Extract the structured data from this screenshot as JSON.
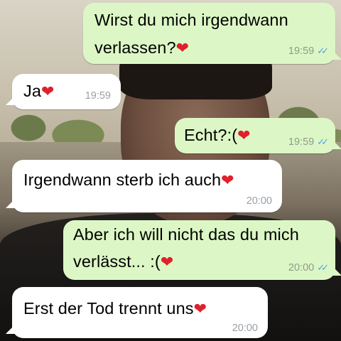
{
  "chat": {
    "messages": [
      {
        "line1": "Wirst du mich irgendwann",
        "line2": "verlassen?",
        "heart": "❤",
        "time": "19:59",
        "ticks": "✓✓"
      },
      {
        "line1": "Ja",
        "heart": "❤",
        "time": "19:59"
      },
      {
        "line1": "Echt?:(",
        "heart": "❤",
        "time": "19:59",
        "ticks": "✓✓"
      },
      {
        "line1": "Irgendwann sterb ich auch",
        "heart": "❤",
        "time": "20:00"
      },
      {
        "line1": "Aber ich will nicht das du mich",
        "line2": "verlässt... :(",
        "heart": "❤",
        "time": "20:00",
        "ticks": "✓✓"
      },
      {
        "line1": "Erst der Tod trennt uns",
        "heart": "❤",
        "time": "20:00"
      }
    ]
  },
  "colors": {
    "outgoing_bubble": "#dcf7c5",
    "incoming_bubble": "#ffffff",
    "read_ticks": "#4aa3e8",
    "heart": "#e0202b"
  },
  "icons": {
    "heart": "heart-icon",
    "read_receipt": "double-check-icon"
  }
}
